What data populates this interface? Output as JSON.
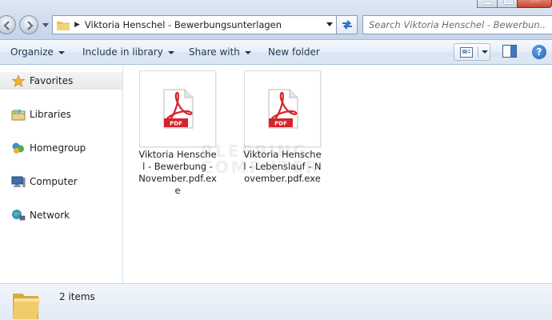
{
  "address": {
    "path": "Viktoria Henschel - Bewerbungsunterlagen"
  },
  "search": {
    "placeholder": "Search Viktoria Henschel - Bewerbun..."
  },
  "toolbar": {
    "organize": "Organize",
    "include_in_library": "Include in library",
    "share_with": "Share with",
    "new_folder": "New folder",
    "help": "?"
  },
  "nav": {
    "favorites": "Favorites",
    "libraries": "Libraries",
    "homegroup": "Homegroup",
    "computer": "Computer",
    "network": "Network"
  },
  "files": [
    {
      "name": "Viktoria Henschel - Bewerbung - November.pdf.exe",
      "type_badge": "PDF"
    },
    {
      "name": "Viktoria Henschel - Lebenslauf - November.pdf.exe",
      "type_badge": "PDF"
    }
  ],
  "watermark": {
    "line1": "BLEEPING",
    "line2": "COMPUTER"
  },
  "status": {
    "item_count": "2 items"
  },
  "colors": {
    "pdf_red": "#d4242c",
    "command_text": "#1e3956"
  }
}
